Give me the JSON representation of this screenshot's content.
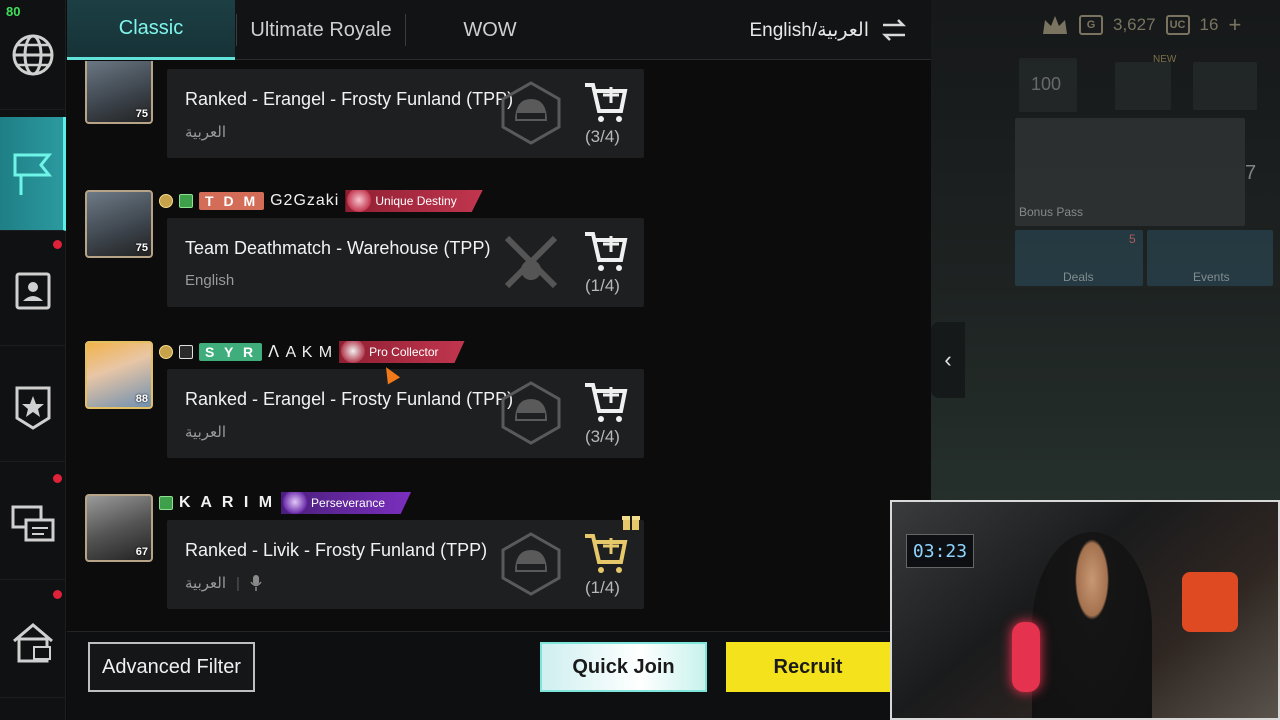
{
  "fps": "80",
  "tabs": [
    {
      "label": "Classic",
      "active": true
    },
    {
      "label": "Ultimate Royale",
      "active": false
    },
    {
      "label": "WOW",
      "active": false
    }
  ],
  "language_toggle": "English/العربية",
  "entries": [
    {
      "mode": "Ranked - Erangel - Frosty Funland (TPP)",
      "language": "العربية",
      "slots": "(3/4)",
      "level": "75",
      "clan": "",
      "player": "",
      "title": "",
      "rank_icon": "helmet-rank-icon"
    },
    {
      "mode": "Team Deathmatch - Warehouse (TPP)",
      "language": "English",
      "slots": "(1/4)",
      "level": "75",
      "clan": "T D M",
      "player": "G2Gzaki",
      "title": "Unique Destiny",
      "rank_icon": "crossed-guns-icon"
    },
    {
      "mode": "Ranked - Erangel - Frosty Funland (TPP)",
      "language": "العربية",
      "slots": "(3/4)",
      "level": "88",
      "clan": "S Y R",
      "player": "ᐱ A K M",
      "title": "Pro Collector",
      "rank_icon": "helmet-rank-icon"
    },
    {
      "mode": "Ranked - Livik - Frosty Funland (TPP)",
      "language": "العربية",
      "slots": "(1/4)",
      "level": "67",
      "clan": "",
      "player": "K A R I M",
      "title": "Perseverance",
      "rank_icon": "helmet-rank-icon"
    }
  ],
  "bottom": {
    "advanced_filter": "Advanced Filter",
    "quick_join": "Quick Join",
    "recruit": "Recruit"
  },
  "right": {
    "currency_g": "3,627",
    "currency_uc": "16",
    "badge_100": "100",
    "new_label": "NEW",
    "bonus_pass": "Bonus Pass",
    "deals": "Deals",
    "deals_count": "5",
    "events": "Events",
    "pager": "7",
    "webcam_clock": "03:23"
  },
  "colors": {
    "accent_teal": "#62e3da",
    "recruit_yellow": "#f4e21c",
    "badge_red": "#c2364f",
    "badge_purple": "#7b2fbf",
    "clan_tdm": "#d36d57",
    "clan_syr": "#3fae7c"
  }
}
